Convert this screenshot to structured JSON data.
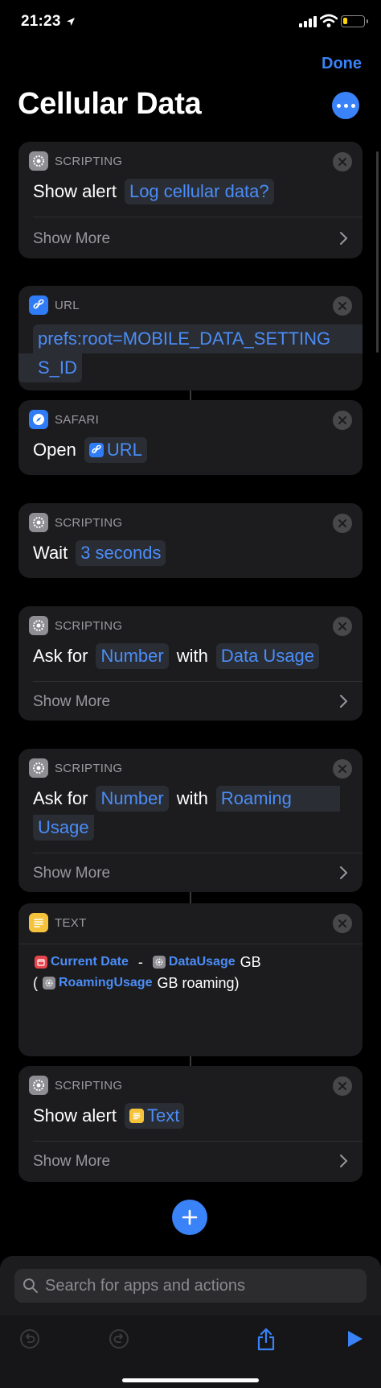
{
  "status": {
    "time": "21:23",
    "battery_level": 0.2,
    "battery_color": "#ffd60a"
  },
  "nav": {
    "done_label": "Done",
    "title": "Cellular Data"
  },
  "colors": {
    "accent": "#3a82f7",
    "card_bg": "#1c1c1e"
  },
  "actions": [
    {
      "category": "SCRIPTING",
      "icon": "gear-icon",
      "verb": "Show alert",
      "param": "Log cellular data?",
      "show_more": "Show More"
    },
    {
      "category": "URL",
      "icon": "link-icon",
      "value_line1": "prefs:root=MOBILE_DATA_SETTING",
      "value_line2": "S_ID"
    },
    {
      "category": "SAFARI",
      "icon": "compass-icon",
      "verb": "Open",
      "param": "URL"
    },
    {
      "category": "SCRIPTING",
      "icon": "gear-icon",
      "verb": "Wait",
      "param": "3 seconds"
    },
    {
      "category": "SCRIPTING",
      "icon": "gear-icon",
      "verb": "Ask for",
      "param": "Number",
      "joiner": "with",
      "param2": "Data Usage",
      "show_more": "Show More"
    },
    {
      "category": "SCRIPTING",
      "icon": "gear-icon",
      "verb": "Ask for",
      "param": "Number",
      "joiner": "with",
      "param2_line1": "Roaming",
      "param2_line2": "Usage",
      "show_more": "Show More"
    },
    {
      "category": "TEXT",
      "icon": "text-icon",
      "var1": "Current Date",
      "sep": "-",
      "var2": "DataUsage",
      "unit1": "GB",
      "open_paren": "(",
      "var3": "RoamingUsage",
      "tail": "GB roaming)"
    },
    {
      "category": "SCRIPTING",
      "icon": "gear-icon",
      "verb": "Show alert",
      "param": "Text",
      "show_more": "Show More"
    }
  ],
  "search": {
    "placeholder": "Search for apps and actions"
  }
}
